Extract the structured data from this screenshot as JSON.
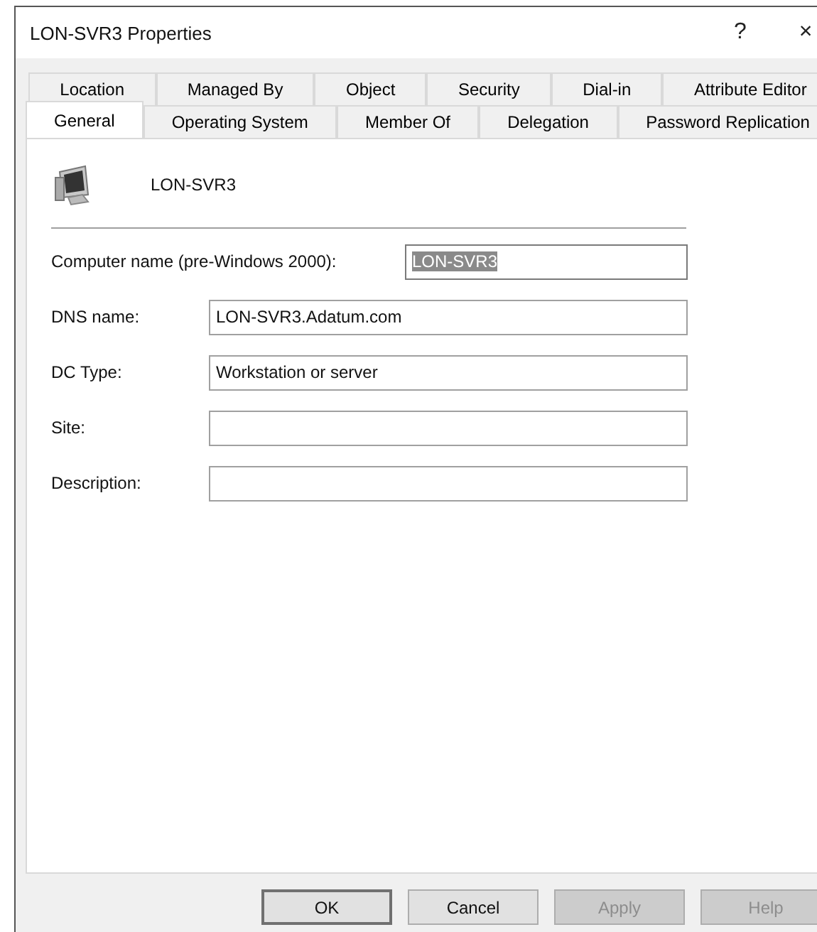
{
  "window": {
    "title": "LON-SVR3 Properties",
    "help_glyph": "?",
    "close_glyph": "×"
  },
  "tab_rows": [
    {
      "tabs": [
        {
          "label": "Location",
          "selected": false
        },
        {
          "label": "Managed By",
          "selected": false
        },
        {
          "label": "Object",
          "selected": false
        },
        {
          "label": "Security",
          "selected": false
        },
        {
          "label": "Dial-in",
          "selected": false
        },
        {
          "label": "Attribute Editor",
          "selected": false
        }
      ]
    },
    {
      "tabs": [
        {
          "label": "General",
          "selected": true
        },
        {
          "label": "Operating System",
          "selected": false
        },
        {
          "label": "Member Of",
          "selected": false
        },
        {
          "label": "Delegation",
          "selected": false
        },
        {
          "label": "Password Replication",
          "selected": false
        }
      ]
    }
  ],
  "header": {
    "name": "LON-SVR3"
  },
  "fields": [
    {
      "label": "Computer name (pre-Windows 2000):",
      "value": "LON-SVR3",
      "text_selected": true,
      "kind": "short"
    },
    {
      "label": "DNS name:",
      "value": "LON-SVR3.Adatum.com",
      "kind": "wide"
    },
    {
      "label": "DC Type:",
      "value": "Workstation or server",
      "kind": "wide"
    },
    {
      "label": "Site:",
      "kind": "wide"
    },
    {
      "label": "Description:",
      "kind": "wide"
    }
  ],
  "buttons": [
    {
      "label": "OK",
      "default": true,
      "disabled": false
    },
    {
      "label": "Cancel",
      "default": false,
      "disabled": false
    },
    {
      "label": "Apply",
      "default": false,
      "disabled": true
    },
    {
      "label": "Help",
      "default": false,
      "disabled": true
    }
  ]
}
